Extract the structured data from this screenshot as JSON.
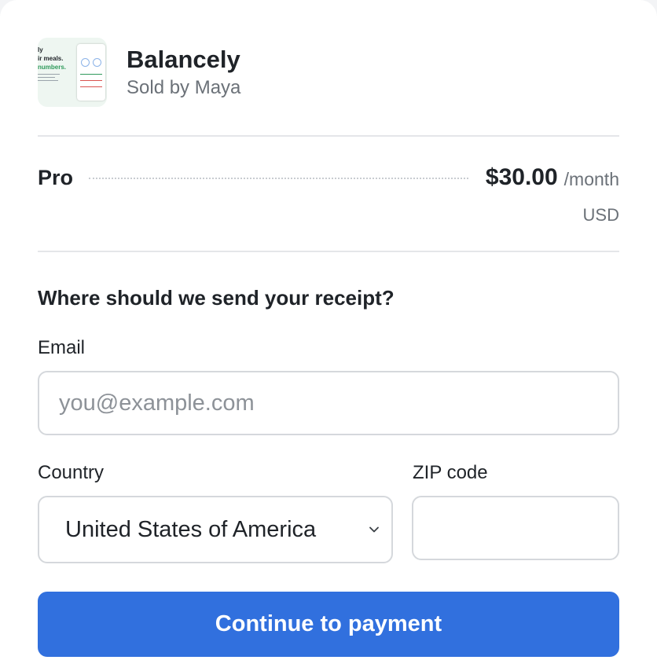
{
  "product": {
    "name": "Balancely",
    "seller": "Sold by Maya",
    "thumbnail": {
      "line1": "ly",
      "line2": "ir meals.",
      "line3": "numbers.",
      "accent": "#2f9a5b"
    }
  },
  "plan": {
    "name": "Pro",
    "price": "$30.00",
    "period": "/month",
    "currency": "USD"
  },
  "form": {
    "heading": "Where should we send your receipt?",
    "email": {
      "label": "Email",
      "placeholder": "you@example.com",
      "value": ""
    },
    "country": {
      "label": "Country",
      "selected": "United States of America"
    },
    "zip": {
      "label": "ZIP code",
      "value": ""
    },
    "submit_label": "Continue to payment"
  },
  "colors": {
    "primary_button": "#3170de",
    "muted_text": "#6b7178",
    "border": "#d5d8dc"
  },
  "icons": {
    "country_dropdown": "chevron-down-icon"
  }
}
